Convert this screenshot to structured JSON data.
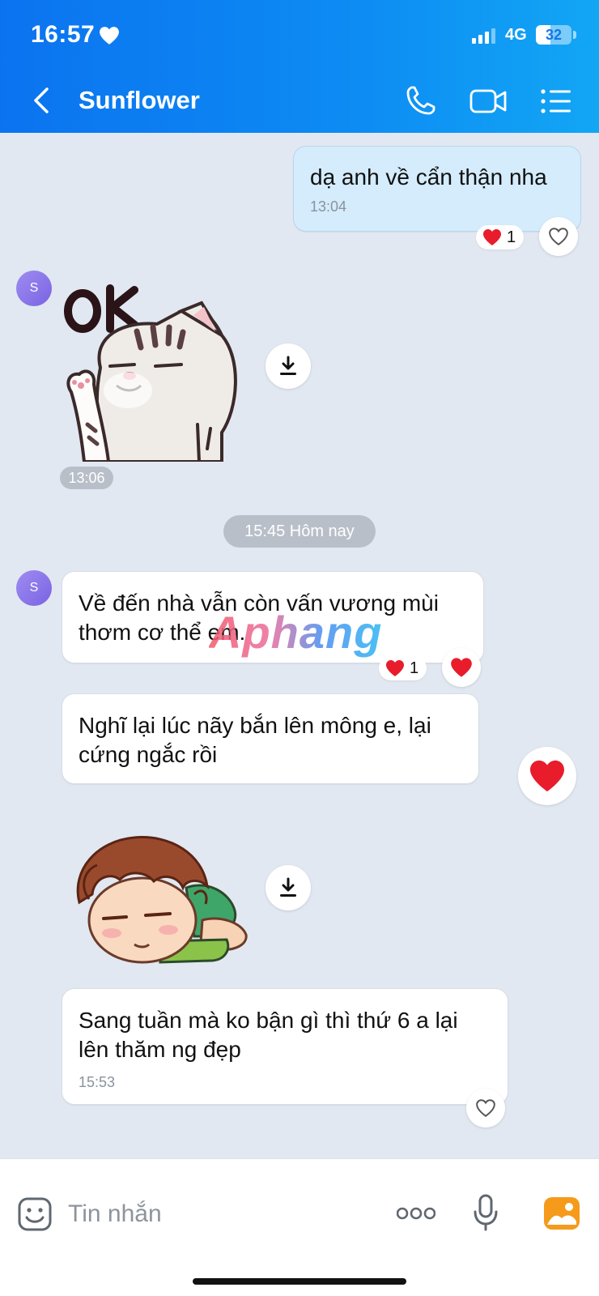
{
  "status_bar": {
    "time": "16:57",
    "network": "4G",
    "battery": "32"
  },
  "header": {
    "title": "Sunflower"
  },
  "messages": [
    {
      "text": "dạ anh về cẩn thận nha",
      "time": "13:04",
      "reaction_count": "1"
    },
    {
      "sticker_time": "13:06"
    },
    {
      "day_separator": "15:45 Hôm nay"
    },
    {
      "text": "Về đến nhà vẫn còn vấn vương mùi thơm cơ thể em.",
      "reaction_count": "1"
    },
    {
      "text": "Nghĩ lại lúc nãy bắn lên mông e, lại cứng ngắc rồi"
    },
    {
      "text": "Sang tuần mà ko bận gì thì thứ 6 a lại lên thăm ng đẹp",
      "time": "15:53"
    }
  ],
  "avatar_letter": "S",
  "watermark": "Aphang",
  "composer": {
    "placeholder": "Tin nhắn"
  },
  "colors": {
    "header_blue": "#0b73f0",
    "sent_bubble": "#d4ecfc",
    "heart_red": "#e81c2b"
  }
}
